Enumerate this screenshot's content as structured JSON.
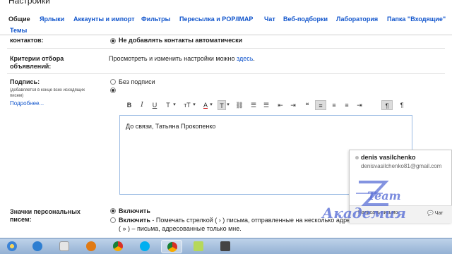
{
  "window": {
    "title": "Настройки"
  },
  "tabs": [
    {
      "label": "Общие",
      "active": true
    },
    {
      "label": "Ярлыки"
    },
    {
      "label": "Аккаунты и импорт"
    },
    {
      "label": "Фильтры"
    },
    {
      "label": "Пересылка и POP/IMAP"
    },
    {
      "label": "Чат"
    },
    {
      "label": "Веб-подборки"
    },
    {
      "label": "Лаборатория"
    },
    {
      "label": "Папка \"Входящие\""
    },
    {
      "label": "Темы"
    }
  ],
  "contacts": {
    "label": "контактов:",
    "option": "Не добавлять контакты автоматически"
  },
  "ads": {
    "label_line1": "Критерии отбора",
    "label_line2": "объявлений:",
    "text": "Просмотреть и изменить настройки можно",
    "link": "здесь",
    "suffix": "."
  },
  "signature": {
    "label": "Подпись:",
    "hint_line1": "(добавляется в конце всех исходящих",
    "hint_line2": "писем)",
    "more_link": "Подробнее...",
    "no_signature": "Без подписи",
    "text": "До связи, Татьяна Прокопенко"
  },
  "toolbar": {
    "bold": "B",
    "italic": "I",
    "underline": "U",
    "font": "T",
    "size": "тT",
    "text_color": "A",
    "highlight": "T",
    "dropdown": "▾",
    "link": "⛓",
    "numbered_list": "☰",
    "bulleted_list": "☰",
    "outdent": "⇤",
    "indent": "⇥",
    "quote": "❝",
    "align_left": "≡",
    "align_center": "≡",
    "align_right": "≡",
    "rtl": "¶",
    "ltr": "¶"
  },
  "icons": {
    "bold": "bold-icon",
    "italic": "italic-icon",
    "underline": "underline-icon",
    "font": "font-icon",
    "size": "font-size-icon",
    "text_color": "text-color-icon",
    "highlight": "highlight-icon",
    "link": "link-icon",
    "numbered_list": "numbered-list-icon",
    "bulleted_list": "bulleted-list-icon",
    "outdent": "outdent-icon",
    "indent": "indent-icon",
    "quote": "quote-icon",
    "align_left": "align-left-icon",
    "align_center": "align-center-icon",
    "align_right": "align-right-icon",
    "rtl": "rtl-icon",
    "ltr": "ltr-icon"
  },
  "personal": {
    "label_line1": "Значки персональных",
    "label_line2": "писем:",
    "enable": "Включить",
    "enable_detail": "Включить",
    "enable_detail_text": "- Помечать стрелкой ( › ) письма, отправленные на несколько адре",
    "enable_detail_line2": "( » ) – письма, адресованные только мне."
  },
  "contact_card": {
    "name": "denis vasilchenko",
    "email": "denisvasilchenko81@gmail.com",
    "send_button": "Написать письмо",
    "chat_button": "Чат"
  },
  "watermark": {
    "line1": "Team",
    "line2": "Академия"
  },
  "taskbar": {
    "items": [
      "start-button",
      "ie-icon",
      "paint-icon",
      "media-player-icon",
      "chrome-icon",
      "skype-icon",
      "chrome-active-icon",
      "notes-icon",
      "camtasia-icon"
    ]
  },
  "colors": {
    "link": "#1155cc",
    "editor_border": "#9bbbe3",
    "watermark": "#5a6fd6",
    "taskbar": "#94b1d4"
  }
}
